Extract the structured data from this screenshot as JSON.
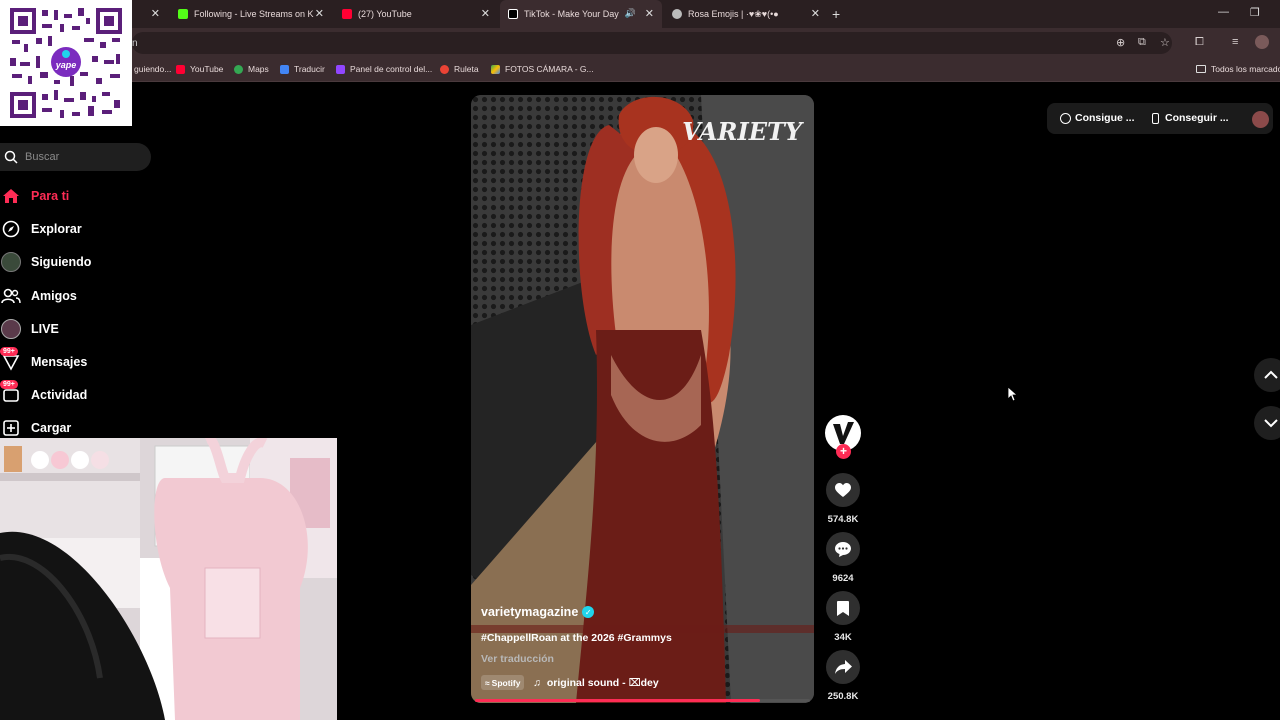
{
  "browser": {
    "tabs": [
      {
        "label": "",
        "favicon_color": "#ffffff"
      },
      {
        "label": "Following - Live Streams on Ki...",
        "favicon_color": "#53fc18"
      },
      {
        "label": "(27) YouTube",
        "favicon_color": "#ff0033"
      },
      {
        "label": "TikTok - Make Your Day",
        "favicon_color": "#ffffff"
      },
      {
        "label": "Rosa Emojis | ·♥❀♥(•●",
        "favicon_color": "#bbbbbb"
      }
    ],
    "address_fragment": "n",
    "bookmarks": [
      {
        "label": "guiendo...",
        "color": "#53fc18"
      },
      {
        "label": "YouTube",
        "color": "#ff0033"
      },
      {
        "label": "Maps",
        "color": "#34a853"
      },
      {
        "label": "Traducir",
        "color": "#4285f4"
      },
      {
        "label": "Panel de control del...",
        "color": "#9146ff"
      },
      {
        "label": "Ruleta",
        "color": "#ea4335"
      },
      {
        "label": "FOTOS CÁMARA - G...",
        "color": "#fbbc04"
      }
    ],
    "all_bookmarks": "Todos los marcado"
  },
  "overlay": {
    "qr_brand": "yape"
  },
  "sidebar": {
    "search_placeholder": "Buscar",
    "items": [
      {
        "label": "Para ti",
        "icon": "home-icon"
      },
      {
        "label": "Explorar",
        "icon": "compass-icon"
      },
      {
        "label": "Siguiendo",
        "icon": "following-avatar-icon"
      },
      {
        "label": "Amigos",
        "icon": "friends-icon"
      },
      {
        "label": "LIVE",
        "icon": "live-icon"
      },
      {
        "label": "Mensajes",
        "icon": "messages-icon",
        "badge": "99+"
      },
      {
        "label": "Actividad",
        "icon": "activity-icon",
        "badge": "99+"
      },
      {
        "label": "Cargar",
        "icon": "upload-icon"
      }
    ]
  },
  "video": {
    "watermark": "VARIETY",
    "author": "varietymagazine",
    "caption": "#ChappellRoan at the 2026 #Grammys",
    "translate": "Ver traducción",
    "spotify": "Spotify",
    "sound": "original sound - ⌧dey",
    "progress": 0.85
  },
  "actions": {
    "likes": "574.8K",
    "comments": "9624",
    "saves": "34K",
    "shares": "250.8K"
  },
  "topbar": {
    "coins": "Consigue ...",
    "app": "Conseguir ..."
  },
  "colors": {
    "accent": "#fe2c55",
    "verified": "#20d5ec"
  }
}
